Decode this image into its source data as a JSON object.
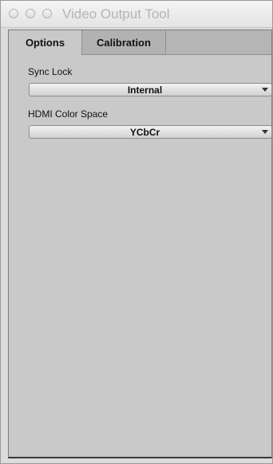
{
  "window": {
    "title": "Video Output Tool"
  },
  "tabs": [
    {
      "label": "Options",
      "active": true
    },
    {
      "label": "Calibration",
      "active": false
    }
  ],
  "options": {
    "sync_lock": {
      "label": "Sync Lock",
      "value": "Internal"
    },
    "hdmi_color_space": {
      "label": "HDMI Color Space",
      "value": "YCbCr"
    }
  },
  "icons": {
    "close": "close-icon",
    "minimize": "minimize-icon",
    "zoom": "zoom-icon",
    "dropdown": "chevron-down-icon"
  }
}
